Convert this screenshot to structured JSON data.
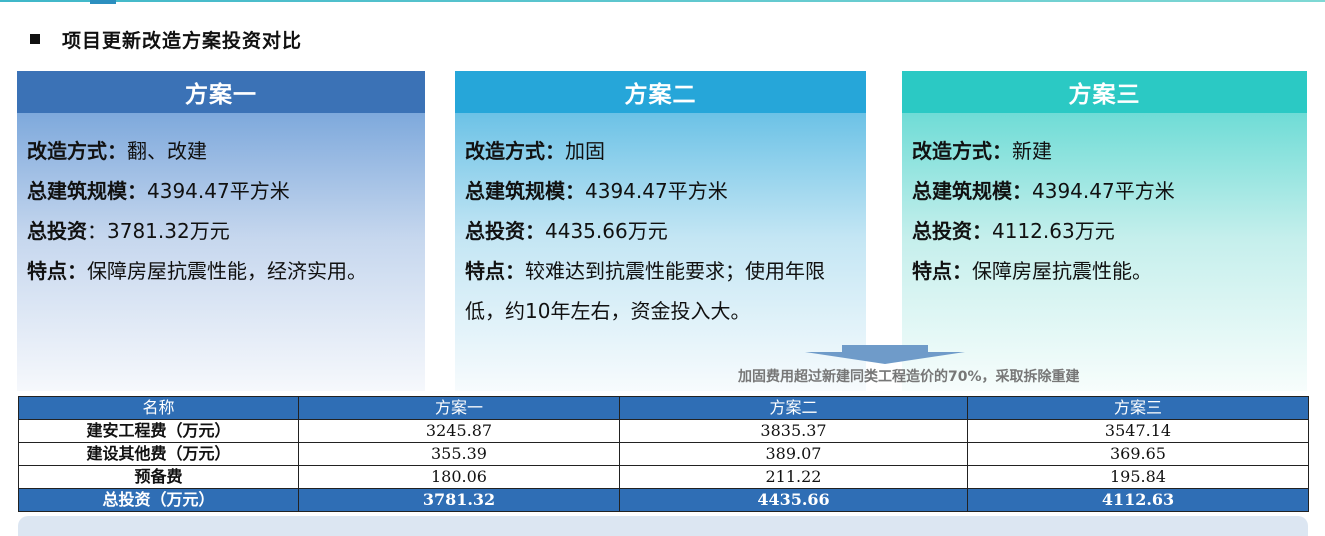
{
  "page_title": "项目更新改造方案投资对比",
  "plans": [
    {
      "name": "方案一",
      "color": "#3b72b6",
      "fields": [
        {
          "label": "改造方式",
          "sep": "：",
          "value": "翻、改建"
        },
        {
          "label": "总建筑规模",
          "sep": "：",
          "value": "4394.47平方米"
        },
        {
          "label": "总投资",
          "sep": "：",
          "value": "3781.32万元"
        },
        {
          "label": "特点",
          "sep": "：",
          "value": "保障房屋抗震性能，经济实用。"
        }
      ]
    },
    {
      "name": "方案二",
      "color": "#26a6d9",
      "fields": [
        {
          "label": "改造方式",
          "sep": "：",
          "value": "加固"
        },
        {
          "label": "总建筑规模",
          "sep": "：",
          "value": "4394.47平方米"
        },
        {
          "label": "总投资",
          "sep": "：",
          "value": "4435.66万元"
        },
        {
          "label": "特点",
          "sep": "：",
          "value": "较难达到抗震性能要求；使用年限低，约10年左右，资金投入大。"
        }
      ]
    },
    {
      "name": "方案三",
      "color": "#2bc9c4",
      "fields": [
        {
          "label": "改造方式",
          "sep": "：",
          "value": "新建"
        },
        {
          "label": "总建筑规模",
          "sep": "：",
          "value": "4394.47平方米"
        },
        {
          "label": "总投资",
          "sep": "：",
          "value": "4112.63万元"
        },
        {
          "label": "特点",
          "sep": "：",
          "value": "保障房屋抗震性能。"
        }
      ]
    }
  ],
  "note": "加固费用超过新建同类工程造价的70%，采取拆除重建",
  "table": {
    "headers": [
      "名称",
      "方案一",
      "方案二",
      "方案三"
    ],
    "rows": [
      [
        "建安工程费（万元）",
        "3245.87",
        "3835.37",
        "3547.14"
      ],
      [
        "建设其他费（万元）",
        "355.39",
        "389.07",
        "369.65"
      ],
      [
        "预备费",
        "180.06",
        "211.22",
        "195.84"
      ]
    ],
    "total": [
      "总投资（万元）",
      "3781.32",
      "4435.66",
      "4112.63"
    ]
  }
}
